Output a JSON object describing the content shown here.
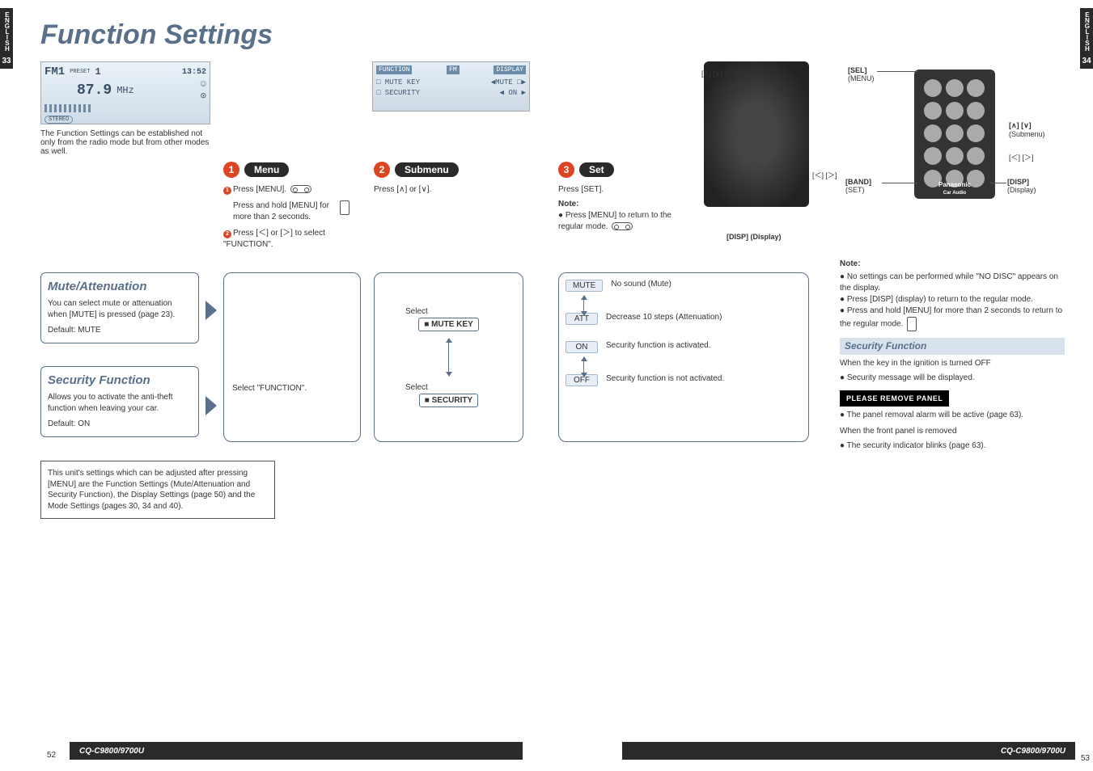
{
  "sideTab": {
    "lang": "ENGLISH",
    "leftPage": "33",
    "rightPage": "34"
  },
  "title": "Function Settings",
  "radioLcd": {
    "band": "FM1",
    "preset": "PRESET",
    "presetNum": "1",
    "freq": "87.9",
    "unit": "MHz",
    "time": "13:52",
    "stereo": "STEREO"
  },
  "radioCaption": "The Function Settings can be established not only from the radio mode but from other modes as well.",
  "funcLcd": {
    "tabFunction": "FUNCTION",
    "tabFM": "FM",
    "tabDisplay": "DISPLAY",
    "line1a": "□ MUTE KEY",
    "line1b": "◀MUTE □▶",
    "line2a": "□ SECURITY",
    "line2b": "◀ ON ▶"
  },
  "steps": {
    "menu": {
      "num": "1",
      "label": "Menu"
    },
    "submenu": {
      "num": "2",
      "label": "Submenu"
    },
    "set": {
      "num": "3",
      "label": "Set"
    }
  },
  "step1": {
    "a_num": "1",
    "a": "Press [MENU].",
    "hold": "Press and hold [MENU] for more than 2 seconds.",
    "b_num": "2",
    "b": "Press [＜] or [＞] to select \"FUNCTION\"."
  },
  "step2": {
    "a": "Press [∧] or [∨]."
  },
  "step3": {
    "a": "Press [SET].",
    "noteHdr": "Note:",
    "note": "Press [MENU] to return to the regular mode."
  },
  "device": {
    "updownSub": "[∧] [∨] (Submenu)",
    "menu": "[MENU]",
    "set": "[SET]",
    "ltr": "[＜] [＞]",
    "disp": "[DISP] (Display)"
  },
  "remote": {
    "sel": "[SEL]",
    "selSub": "(MENU)",
    "updown": "[∧] [∨]",
    "updownSub": "(Submenu)",
    "ltr": "[＜] [＞]",
    "band": "[BAND]",
    "bandSub": "(SET)",
    "disp": "[DISP]",
    "dispSub": "(Display)",
    "brand": "Panasonic",
    "brandSub": "Car Audio"
  },
  "muteBox": {
    "title": "Mute/Attenuation",
    "body": "You can select mute or attenuation when [MUTE] is pressed (page 23).",
    "default": "Default: MUTE"
  },
  "secBox": {
    "title": "Security Function",
    "body": "Allows you to activate the anti-theft function when leaving your car.",
    "default": "Default: ON"
  },
  "boxFunc": {
    "text": "Select \"FUNCTION\"."
  },
  "boxSel": {
    "selectLabel": "Select",
    "muteKey": "MUTE KEY",
    "security": "SECURITY"
  },
  "boxSet": {
    "mute": {
      "btn": "MUTE",
      "desc": "No sound (Mute)"
    },
    "att": {
      "btn": "ATT",
      "desc": "Decrease 10 steps (Attenuation)"
    },
    "on": {
      "btn": "ON",
      "desc": "Security function is activated."
    },
    "off": {
      "btn": "OFF",
      "desc": "Security function is not activated."
    }
  },
  "noteBlock": {
    "hdr": "Note:",
    "li1": "No settings can be performed while \"NO DISC\" appears on the display.",
    "li2": "Press [DISP] (display) to return to the regular mode.",
    "li3": "Press and hold [MENU]  for more than 2 seconds to return to the regular mode.",
    "secFuncTitle": "Security Function",
    "p1": "When the key in the ignition is turned OFF",
    "p1b": "Security message will be displayed.",
    "removePanel": "PLEASE REMOVE PANEL",
    "p2": "The panel removal alarm will be active (page 63).",
    "p3": "When the front panel is removed",
    "p3b": "The security indicator blinks (page 63)."
  },
  "bottomBox": "This unit's settings which can be adjusted after pressing [MENU] are the Function Settings (Mute/Attenuation and Security Function), the Display Settings (page 50) and the Mode Settings (pages 30, 34 and 40).",
  "footer": {
    "model": "CQ-C9800/9700U",
    "pg52": "52",
    "pg53": "53"
  }
}
